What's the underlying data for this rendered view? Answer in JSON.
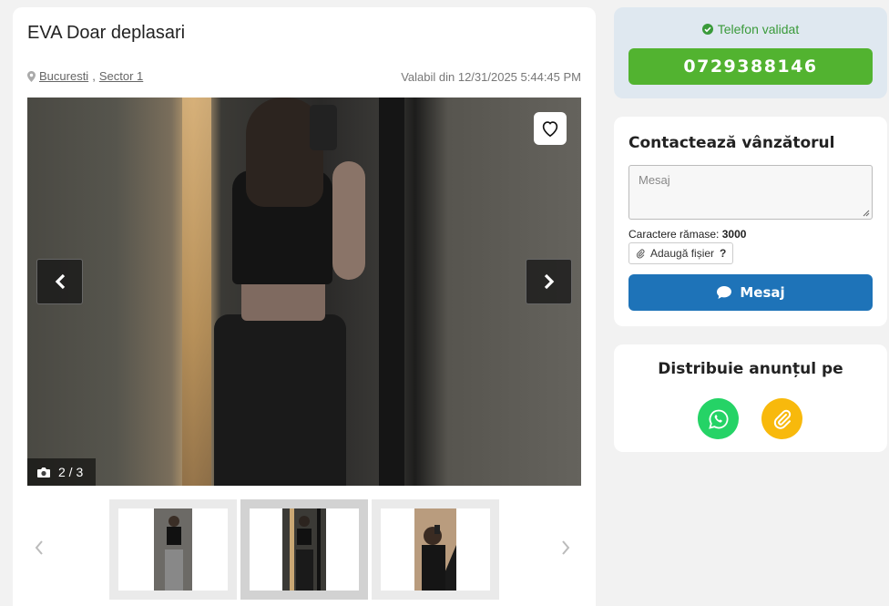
{
  "listing": {
    "title": "EVA Doar deplasari",
    "city": "Bucuresti",
    "sector": "Sector 1",
    "valid_from": "Valabil din 12/31/2025 5:44:45 PM"
  },
  "gallery": {
    "counter": "2 / 3",
    "current_index": 2,
    "total": 3,
    "thumbnails": [
      "thumb-1",
      "thumb-2",
      "thumb-3"
    ],
    "active_thumbnail": 2
  },
  "phone": {
    "validated_label": "Telefon validat",
    "number": "0729388146"
  },
  "contact": {
    "title": "Contactează vânzătorul",
    "message_placeholder": "Mesaj",
    "chars_label": "Caractere rămase:",
    "chars_remaining": "3000",
    "attach_label": "Adaugă fișier",
    "attach_help": "?",
    "send_label": "Mesaj"
  },
  "share": {
    "title": "Distribuie anunțul pe"
  },
  "colors": {
    "validated_green": "#3a9a3a",
    "phone_button": "#52b330",
    "send_button": "#1e73b8",
    "whatsapp": "#25d366",
    "link": "#f8b90c"
  },
  "icons": {
    "location": "map-pin-icon",
    "favorite": "heart-icon",
    "prev": "chevron-left-icon",
    "next": "chevron-right-icon",
    "camera": "camera-icon",
    "check": "check-circle-icon",
    "attach": "paperclip-icon",
    "chat": "chat-bubble-icon",
    "whatsapp": "whatsapp-icon",
    "link": "paperclip-icon"
  }
}
